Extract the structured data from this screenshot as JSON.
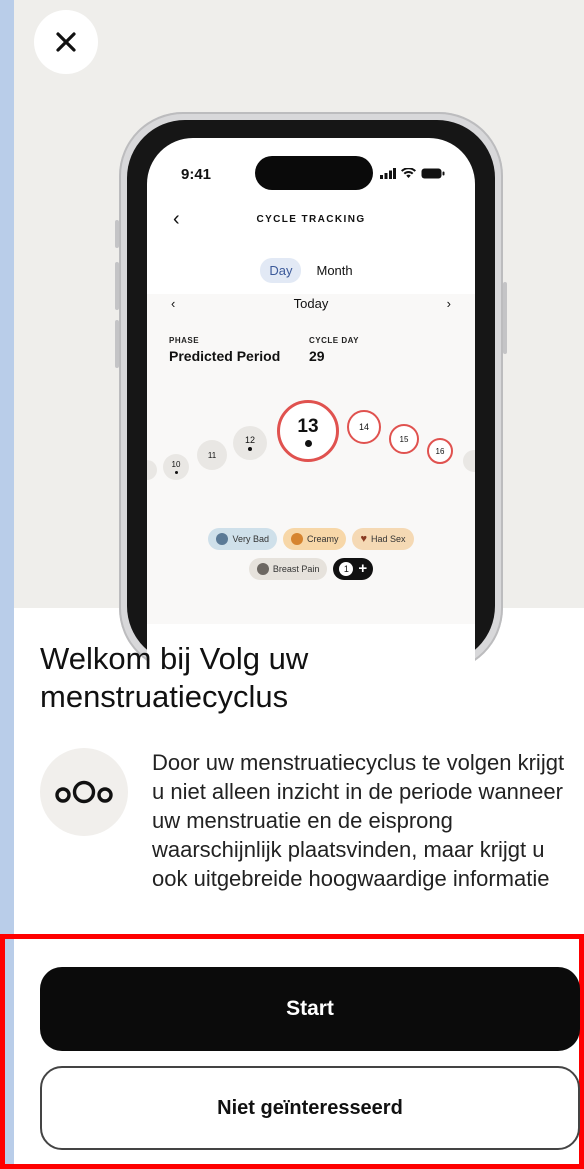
{
  "close": {
    "icon": "close-icon"
  },
  "phone_preview": {
    "status_time": "9:41",
    "nav_title": "CYCLE TRACKING",
    "segments": {
      "day": "Day",
      "month": "Month",
      "active": "Day"
    },
    "date_label": "Today",
    "phase_label": "PHASE",
    "phase_value": "Predicted Period",
    "cycle_day_label": "CYCLE DAY",
    "cycle_day_value": "29",
    "days": [
      "10",
      "11",
      "12",
      "13",
      "14",
      "15",
      "16"
    ],
    "chips": [
      "Very Bad",
      "Creamy",
      "Had Sex",
      "Breast Pain"
    ],
    "more_count": "1",
    "more_icon": "plus-icon"
  },
  "welcome": {
    "title": "Welkom bij Volg uw menstruatiecyclus",
    "description": "Door uw menstruatiecyclus te volgen krijgt u niet alleen inzicht in de periode wanneer uw menstruatie en de eisprong waarschijnlijk plaatsvinden, maar krijgt u ook uitgebreide hoogwaardige informatie",
    "logo_icon": "cycle-logo-icon"
  },
  "actions": {
    "start_label": "Start",
    "decline_label": "Niet geïnteresseerd"
  },
  "colors": {
    "background_blue": "#b9cde9",
    "primary_button": "#0b0b0b",
    "highlight_border": "#ff0000",
    "period_red": "#e0524f"
  }
}
